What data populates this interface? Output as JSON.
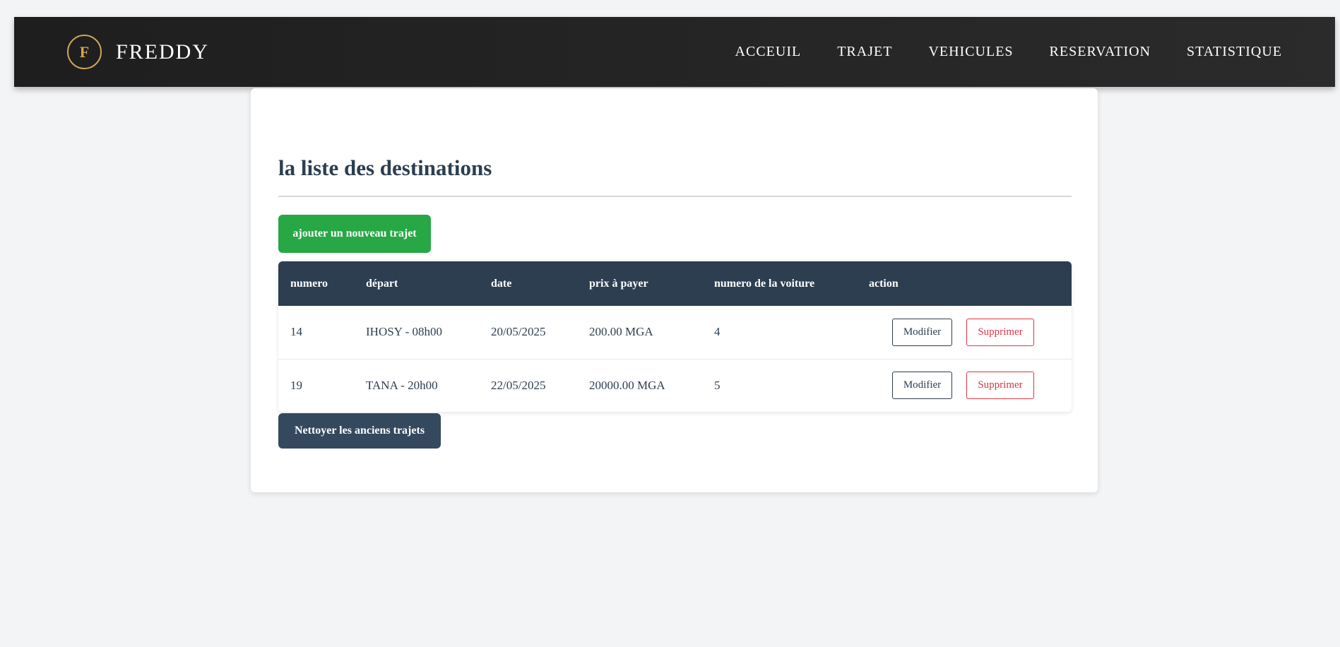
{
  "navbar": {
    "logo_letter": "F",
    "brand": "FREDDY",
    "links": [
      "ACCEUIL",
      "TRAJET",
      "VEHICULES",
      "RESERVATION",
      "STATISTIQUE"
    ]
  },
  "main": {
    "title": "la liste des destinations",
    "add_button": "ajouter un nouveau trajet",
    "clean_button": "Nettoyer les anciens trajets"
  },
  "table": {
    "headers": [
      "numero",
      "départ",
      "date",
      "prix à payer",
      "numero de la voiture",
      "action"
    ],
    "rows": [
      {
        "numero": "14",
        "depart": "IHOSY - 08h00",
        "date": "20/05/2025",
        "prix": "200.00 MGA",
        "voiture": "4",
        "edit": "Modifier",
        "delete": "Supprimer"
      },
      {
        "numero": "19",
        "depart": "TANA - 20h00",
        "date": "22/05/2025",
        "prix": "20000.00 MGA",
        "voiture": "5",
        "edit": "Modifier",
        "delete": "Supprimer"
      }
    ]
  },
  "colors": {
    "accent_gold": "#d4a45a",
    "header_dark": "#2c3e50",
    "add_green": "#28a745",
    "delete_red": "#dc3545"
  }
}
